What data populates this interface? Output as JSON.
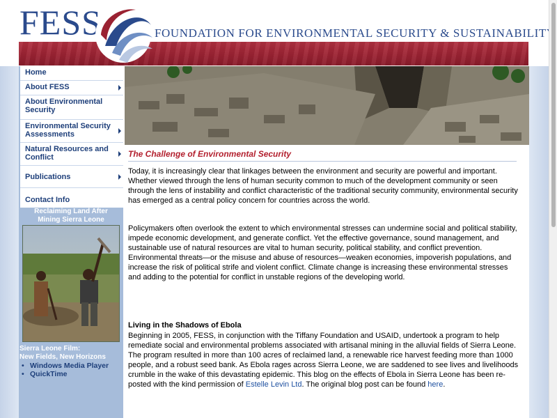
{
  "header": {
    "logo_text": "FESS",
    "tagline": "FOUNDATION FOR ENVIRONMENTAL SECURITY & SUSTAINABILITY"
  },
  "nav": {
    "items": [
      {
        "label": "Home",
        "has_submenu": false
      },
      {
        "label": "About FESS",
        "has_submenu": true
      },
      {
        "label": "About Environmental Security",
        "has_submenu": false
      },
      {
        "label": "Environmental Security Assessments",
        "has_submenu": true
      },
      {
        "label": "Natural Resources and Conflict",
        "has_submenu": true
      },
      {
        "label": "Publications",
        "has_submenu": true
      },
      {
        "label": "Contact Info",
        "has_submenu": false
      }
    ]
  },
  "promo": {
    "title_line1": "Reclaiming Land After",
    "title_line2": "Mining Sierra Leone"
  },
  "film": {
    "title_line1": "Sierra Leone Film:",
    "title_line2": "New Fields, New Horizons",
    "links": [
      "Windows Media Player",
      "QuickTime"
    ]
  },
  "main": {
    "section_title": "The Challenge of Environmental Security",
    "paragraph1": "Today, it is increasingly clear that linkages between the environment and security are powerful and important. Whether viewed through the lens of human security common to much of the development community or seen through the lens of instability and conflict characteristic of the traditional security community, environmental security has emerged as a central policy concern for countries across the world.",
    "paragraph2": "Policymakers often overlook the extent to which environmental stresses can undermine social and political stability, impede economic development, and generate conflict. Yet the effective governance, sound management, and sustainable use of natural resources are vital to human security, political stability, and conflict prevention. Environmental threats—or the misuse and abuse of resources—weaken economies, impoverish populations, and increase the risk of political strife and violent conflict. Climate change is increasing these environmental stresses and adding to the potential for conflict in unstable regions of the developing world.",
    "ebola_heading": "Living in the Shadows of Ebola",
    "ebola_text_start": "Beginning in 2005, FESS, in conjunction with the Tiffany Foundation and USAID, undertook a program to help remediate social and environmental problems associated with artisanal mining in the alluvial fields of Sierra Leone. The program resulted in more than 100 acres of reclaimed land, a renewable rice harvest feeding more than 1000 people, and a robust seed bank. As Ebola rages across Sierra Leone, we are saddened to see lives and livelihoods crumble in the wake of this devastating epidemic. This blog on the effects of Ebola in Sierra Leone has been re-posted with the kind permission of ",
    "ebola_link1": "Estelle Levin Ltd",
    "ebola_text_mid": ". The original blog post can be found ",
    "ebola_link2": "here",
    "ebola_text_end": "."
  },
  "colors": {
    "brand_blue": "#2a4a8c",
    "band_red": "#9a2232",
    "sidebar_blue": "#a6bcda",
    "title_red": "#b3202e"
  }
}
